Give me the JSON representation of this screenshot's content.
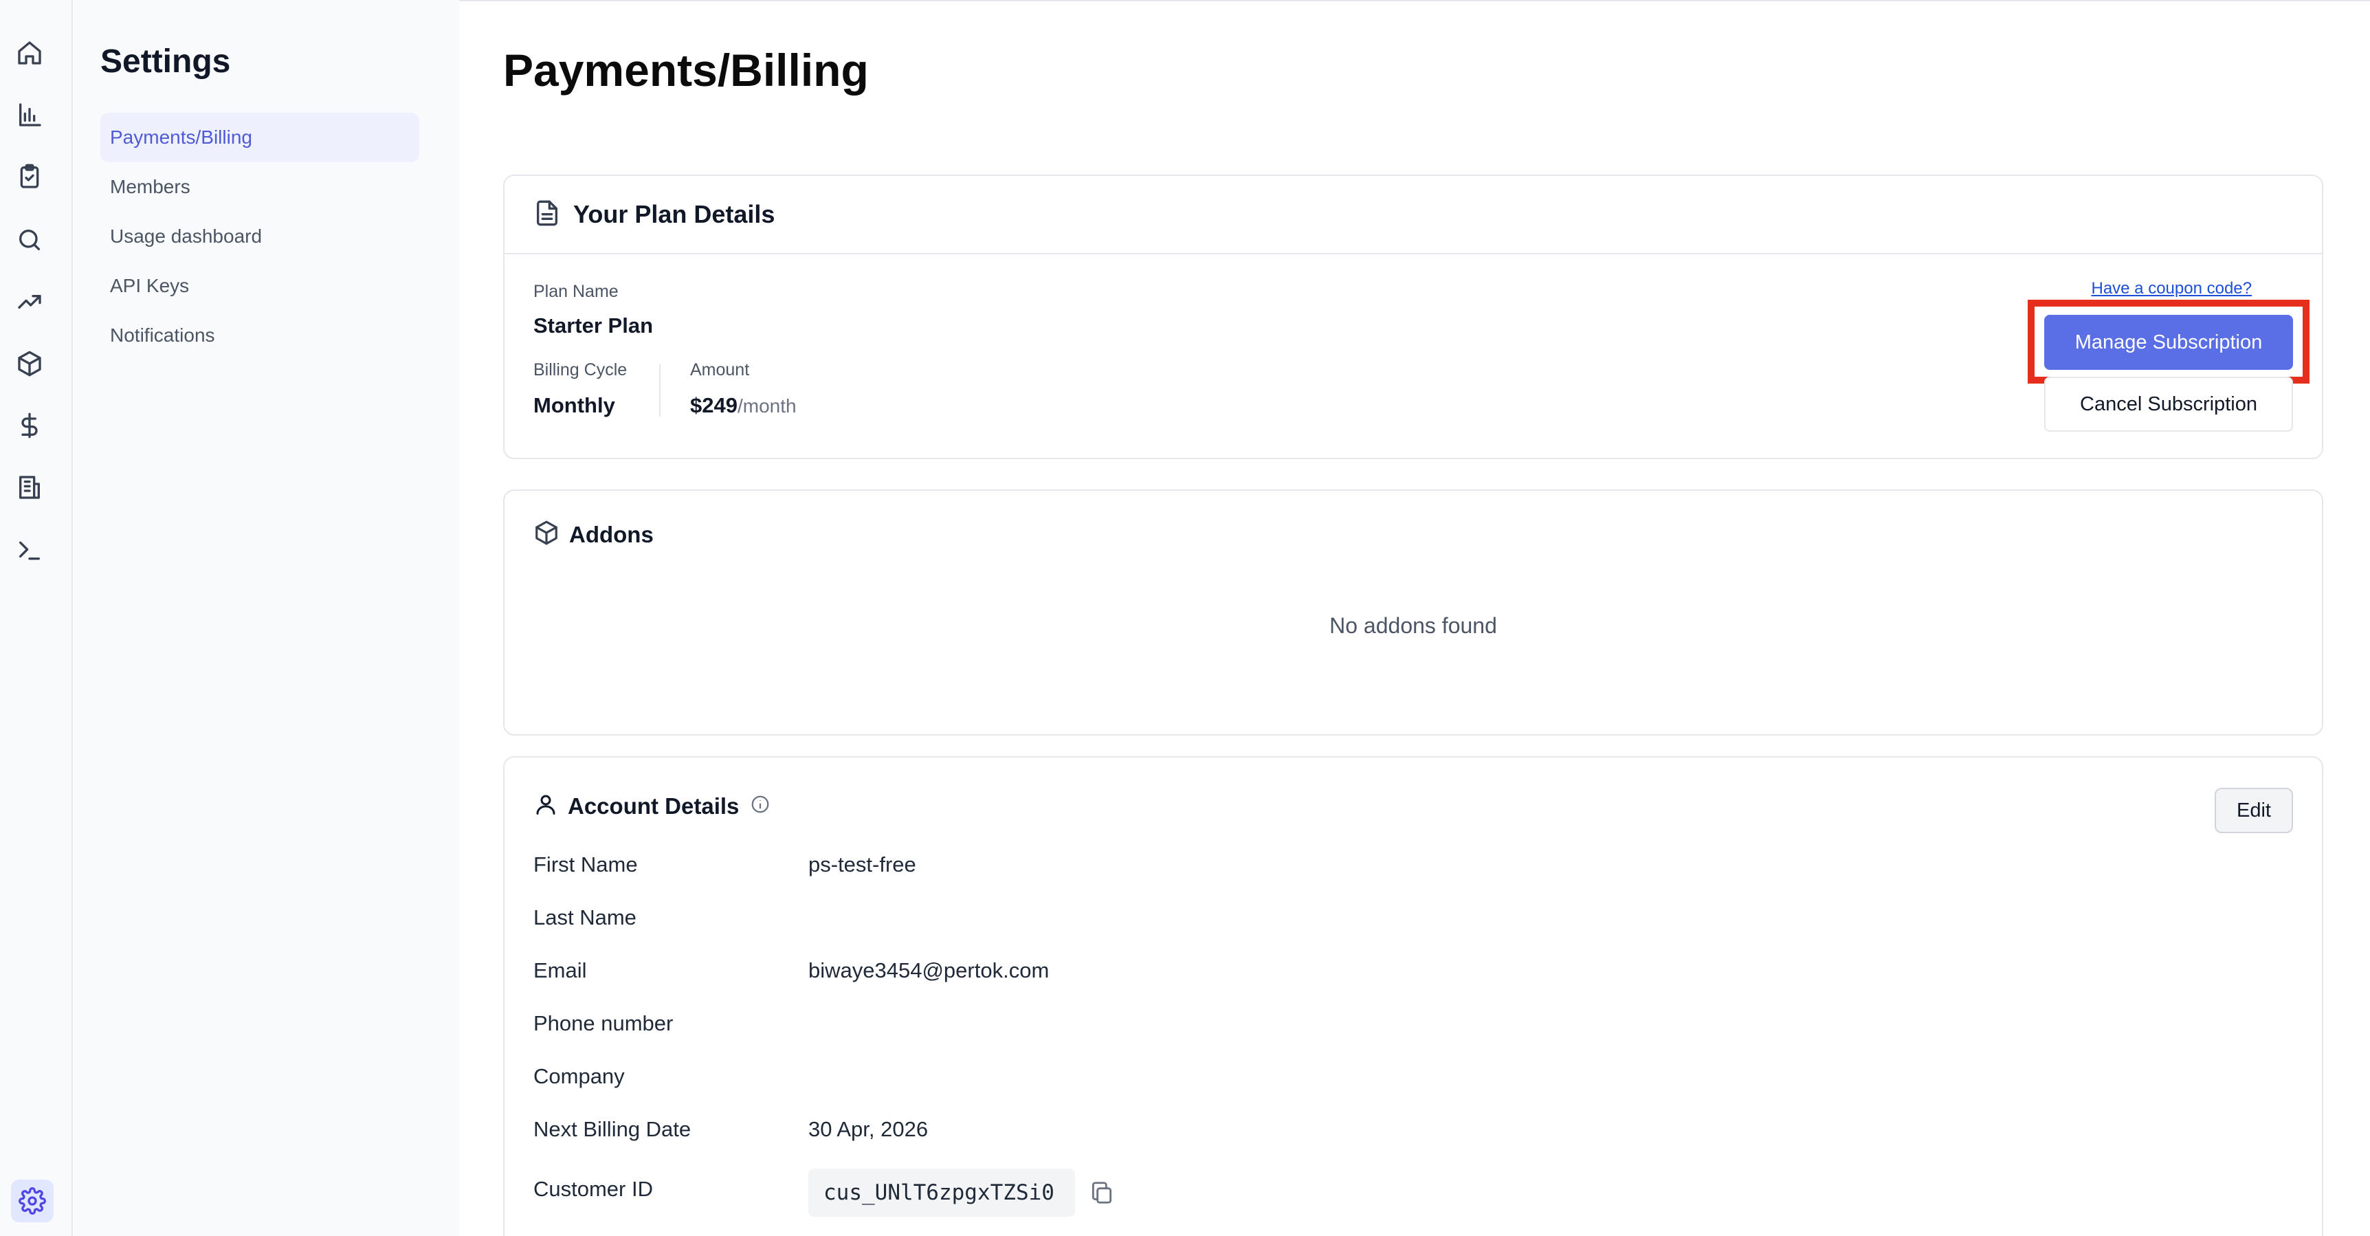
{
  "nav_icons": [
    "home-icon",
    "bar-chart-icon",
    "clipboard-check-icon",
    "search-icon",
    "trending-up-icon",
    "package-icon",
    "dollar-icon",
    "building-icon",
    "terminal-icon",
    "gear-icon"
  ],
  "sidebar": {
    "title": "Settings",
    "items": [
      {
        "label": "Payments/Billing",
        "active": true
      },
      {
        "label": "Members"
      },
      {
        "label": "Usage dashboard"
      },
      {
        "label": "API Keys"
      },
      {
        "label": "Notifications"
      }
    ]
  },
  "page": {
    "title": "Payments/Billing"
  },
  "plan": {
    "title": "Your Plan Details",
    "plan_name_label": "Plan Name",
    "plan_name": "Starter Plan",
    "billing_cycle_label": "Billing Cycle",
    "billing_cycle": "Monthly",
    "amount_label": "Amount",
    "amount": "$249",
    "amount_unit": "/month",
    "coupon_link": "Have a coupon code?",
    "manage_button": "Manage Subscription",
    "cancel_button": "Cancel Subscription"
  },
  "addons": {
    "title": "Addons",
    "empty": "No addons found"
  },
  "account": {
    "title": "Account Details",
    "edit_button": "Edit",
    "fields": [
      {
        "label": "First Name",
        "value": "ps-test-free"
      },
      {
        "label": "Last Name",
        "value": ""
      },
      {
        "label": "Email",
        "value": "biwaye3454@pertok.com"
      },
      {
        "label": "Phone number",
        "value": ""
      },
      {
        "label": "Company",
        "value": ""
      },
      {
        "label": "Next Billing Date",
        "value": "30 Apr, 2026"
      },
      {
        "label": "Customer ID",
        "value": "cus_UNlT6zpgxTZSi0"
      }
    ]
  },
  "colors": {
    "accent": "#5a6fe6",
    "active_nav_text": "#4f5bd5",
    "active_nav_bg": "#eef0fd",
    "highlight": "#e62e1c"
  }
}
